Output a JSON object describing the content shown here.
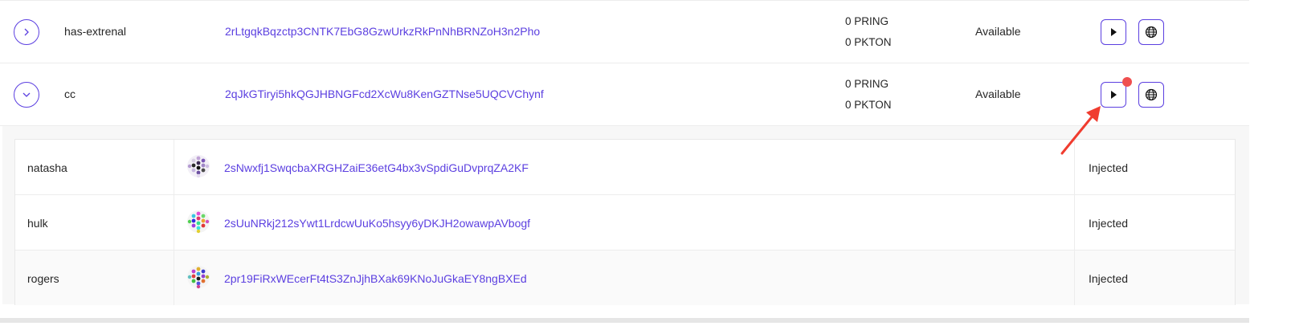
{
  "accounts": [
    {
      "name": "has-extrenal",
      "address": "2rLtgqkBqzctp3CNTK7EbG8GzwUrkzRkPnNhBRNZoH3n2Pho",
      "balances": [
        "0 PRING",
        "0 PKTON"
      ],
      "status": "Available",
      "expanded": false
    },
    {
      "name": "cc",
      "address": "2qJkGTiryi5hkQGJHBNGFcd2XcWu8KenGZTNse5UQCVChynf",
      "balances": [
        "0 PRING",
        "0 PKTON"
      ],
      "status": "Available",
      "expanded": true
    }
  ],
  "signatories": [
    {
      "name": "natasha",
      "address": "2sNwxfj1SwqcbaXRGHZaiE36etG4bx3vSpdiGuDvprqZA2KF",
      "status": "Injected"
    },
    {
      "name": "hulk",
      "address": "2sUuNRkj212sYwt1LrdcwUuKo5hsyy6yDKJH2owawpAVbogf",
      "status": "Injected"
    },
    {
      "name": "rogers",
      "address": "2pr19FiRxWEcerFt4tS3ZnJjhBXak69KNoJuGkaEY8ngBXEd",
      "status": "Injected"
    }
  ],
  "icons": {
    "expand_collapsed": "chevron-right-icon",
    "expand_open": "chevron-down-icon",
    "action_play": "play-icon",
    "action_globe": "globe-icon",
    "avatar": "identicon"
  },
  "colors": {
    "accent": "#5b3fe0",
    "notification": "#ef4f4f",
    "annotation_arrow": "#f03c2f",
    "panel_bg": "#f7f7f7"
  }
}
